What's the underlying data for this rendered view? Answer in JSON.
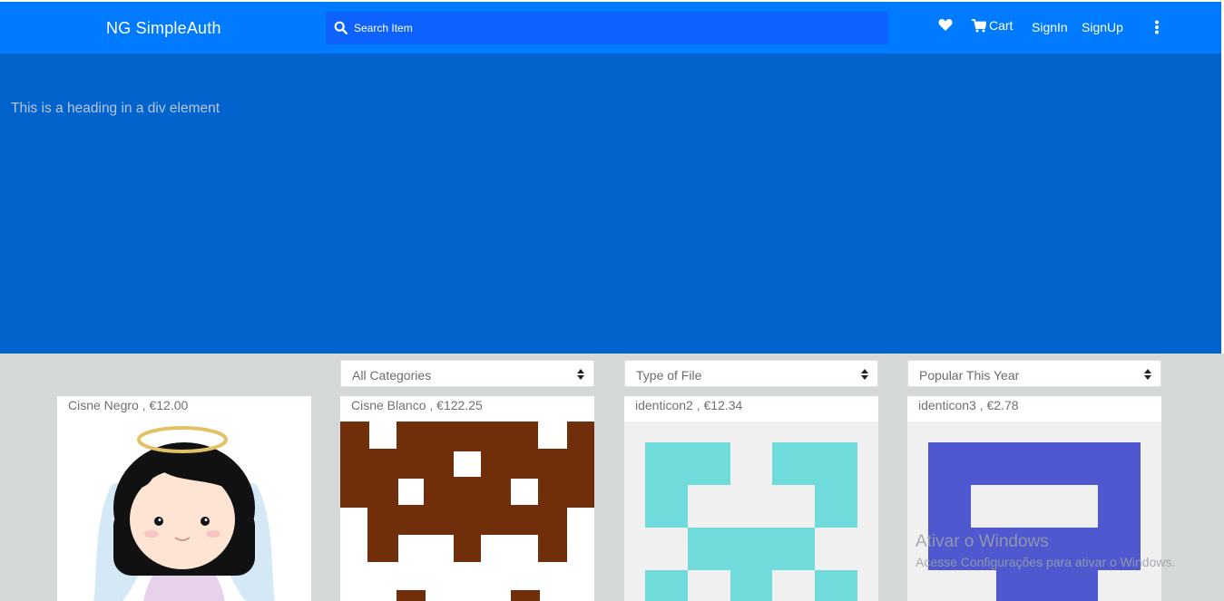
{
  "navbar": {
    "brand": "NG SimpleAuth",
    "search_placeholder": "Search Item",
    "cart_label": "Cart",
    "signin_label": "SignIn",
    "signup_label": "SignUp",
    "icons": [
      "heart-icon",
      "cart-icon",
      "more-vertical-icon",
      "search-icon"
    ],
    "color": "#007bff"
  },
  "hero": {
    "heading": "This is a heading in a div element",
    "color": "#0363cd"
  },
  "filters": {
    "category": "All Categories",
    "file_type": "Type of File",
    "sort": "Popular This Year"
  },
  "products": [
    {
      "name": "Cisne Negro",
      "price": "€12.00",
      "label": "Cisne Negro , €12.00"
    },
    {
      "name": "Cisne Blanco",
      "price": "€122.25",
      "label": "Cisne Blanco , €122.25"
    },
    {
      "name": "identicon2",
      "price": "€12.34",
      "label": "identicon2 , €12.34"
    },
    {
      "name": "identicon3",
      "price": "€2.78",
      "label": "identicon3 , €2.78"
    }
  ],
  "watermark": {
    "title": "Ativar o Windows",
    "subtitle": "Acesse Configurações para ativar o Windows."
  }
}
